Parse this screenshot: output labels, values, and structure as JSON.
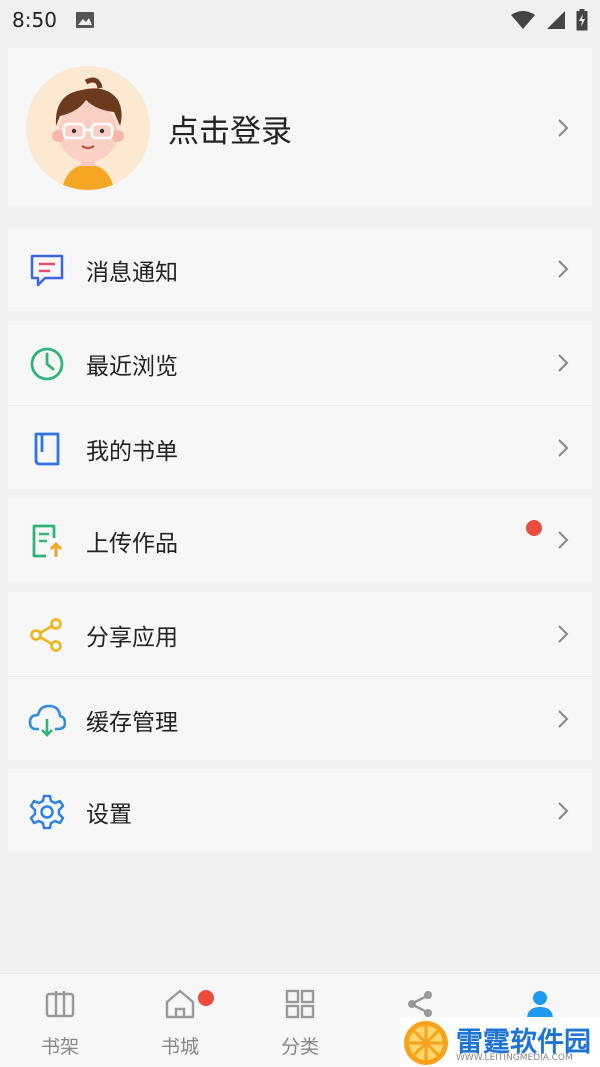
{
  "status_bar": {
    "time": "8:50"
  },
  "profile": {
    "login_label": "点击登录"
  },
  "menu_groups": [
    [
      {
        "label": "消息通知",
        "icon": "message-icon",
        "color": "#3d63e6"
      }
    ],
    [
      {
        "label": "最近浏览",
        "icon": "clock-icon",
        "color": "#2fb57a"
      },
      {
        "label": "我的书单",
        "icon": "booklist-icon",
        "color": "#2f73e8"
      }
    ],
    [
      {
        "label": "上传作品",
        "icon": "upload-doc-icon",
        "color": "#2fb57a",
        "badge": true
      }
    ],
    [
      {
        "label": "分享应用",
        "icon": "share-icon",
        "color": "#f2b31a"
      },
      {
        "label": "缓存管理",
        "icon": "cloud-download-icon",
        "color": "#2f8ae8"
      }
    ],
    [
      {
        "label": "设置",
        "icon": "gear-icon",
        "color": "#2f80e8"
      }
    ]
  ],
  "tabbar": {
    "tabs": [
      {
        "label": "书架",
        "icon": "bookshelf-icon",
        "active": false
      },
      {
        "label": "书城",
        "icon": "home-icon",
        "active": false,
        "badge": true
      },
      {
        "label": "分类",
        "icon": "category-icon",
        "active": false
      },
      {
        "label": "",
        "icon": "share-icon",
        "active": false
      },
      {
        "label": "",
        "icon": "user-icon",
        "active": true
      }
    ]
  },
  "watermark": {
    "title": "雷霆软件园",
    "subtitle": "WWW.LEITINGMEDIA.COM"
  },
  "colors": {
    "accent": "#1e9af0",
    "badge": "#ea4b3d",
    "card": "#f7f7f7",
    "background": "#f0f0f0"
  }
}
